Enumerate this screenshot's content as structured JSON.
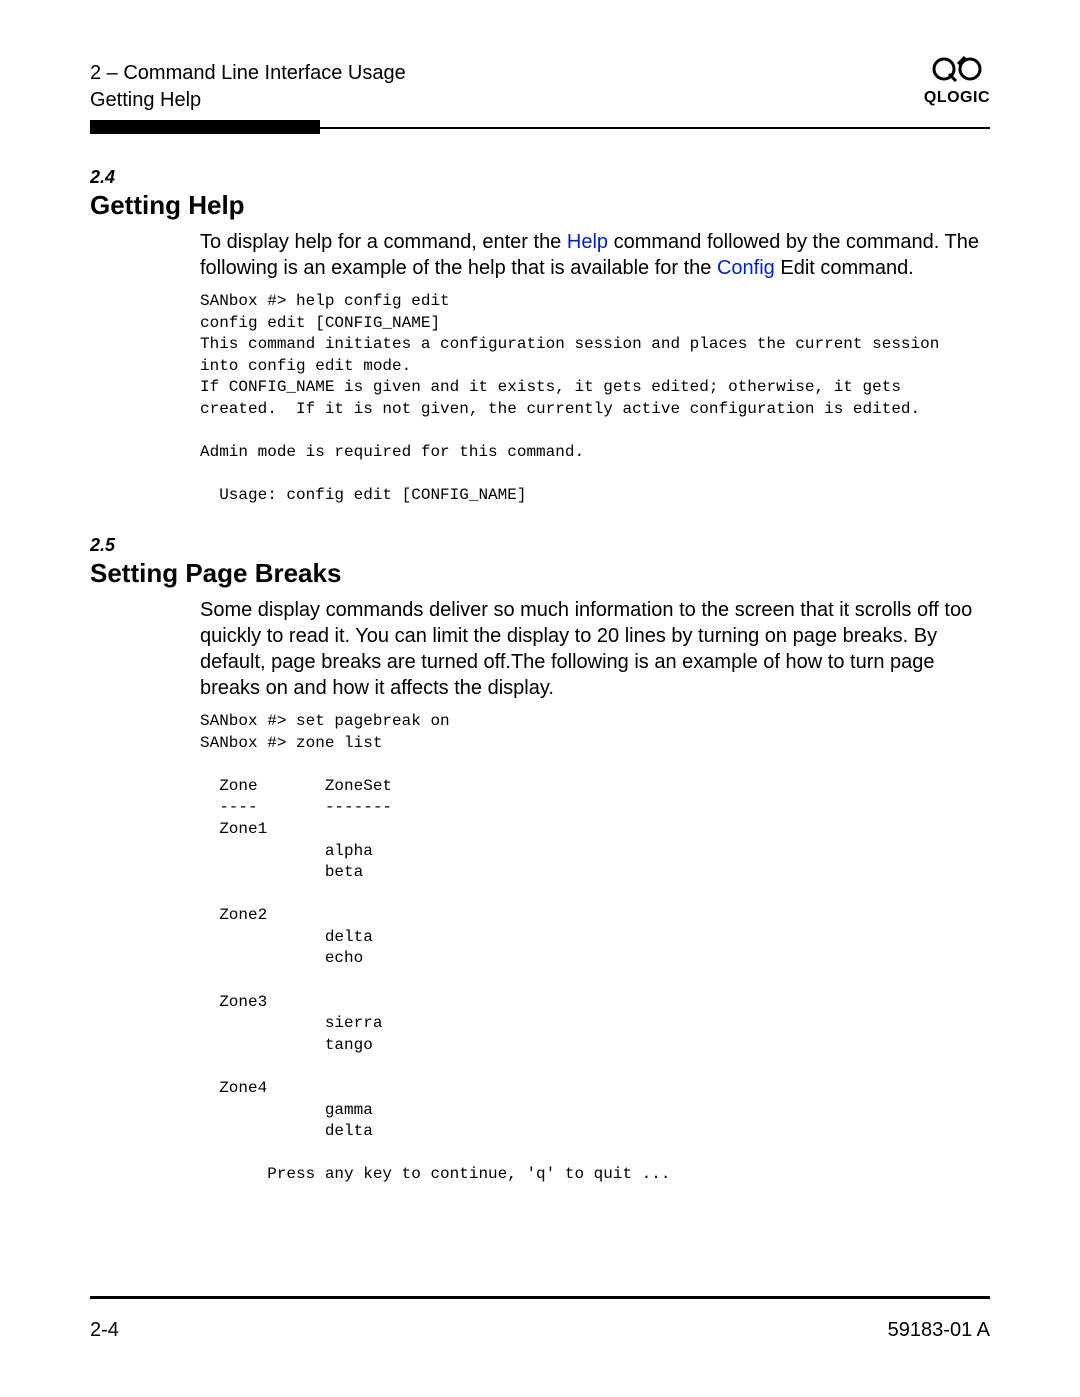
{
  "header": {
    "line1": "2 – Command Line Interface Usage",
    "line2": "Getting Help",
    "brand": "QLOGIC"
  },
  "section1": {
    "number": "2.4",
    "title": "Getting Help",
    "para_pre": "To display help for a command, enter the ",
    "link1": "Help",
    "para_mid": " command followed by the command. The following is an example of the help that is available for the ",
    "link2": "Config",
    "para_post": " Edit command.",
    "code": "SANbox #> help config edit\nconfig edit [CONFIG_NAME]\nThis command initiates a configuration session and places the current session\ninto config edit mode.\nIf CONFIG_NAME is given and it exists, it gets edited; otherwise, it gets\ncreated.  If it is not given, the currently active configuration is edited.\n\nAdmin mode is required for this command.\n\n  Usage: config edit [CONFIG_NAME]"
  },
  "section2": {
    "number": "2.5",
    "title": "Setting Page Breaks",
    "para": "Some display commands deliver so much information to the screen that it scrolls off too quickly to read it. You can limit the display to 20 lines by turning on page breaks. By default, page breaks are turned off.The following is an example of how to turn page breaks on and how it affects the display.",
    "code": "SANbox #> set pagebreak on\nSANbox #> zone list\n\n  Zone       ZoneSet\n  ----       -------\n  Zone1\n             alpha\n             beta\n\n  Zone2\n             delta\n             echo\n\n  Zone3\n             sierra\n             tango\n\n  Zone4\n             gamma\n             delta\n\n       Press any key to continue, 'q' to quit ..."
  },
  "footer": {
    "left": "2-4",
    "right": "59183-01 A"
  }
}
